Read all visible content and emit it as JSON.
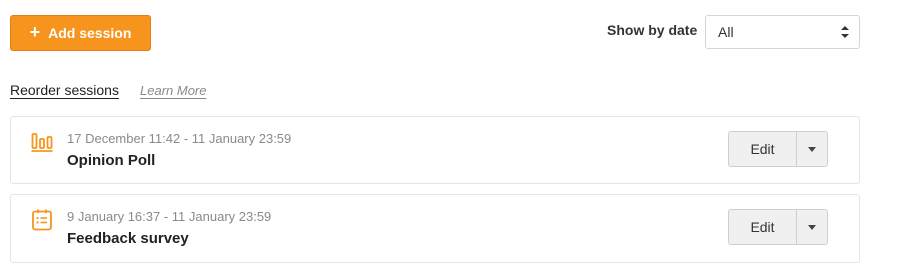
{
  "toolbar": {
    "add_session_label": "Add session",
    "show_by_date_label": "Show by date",
    "date_filter": {
      "selected": "All"
    }
  },
  "links": {
    "reorder": "Reorder sessions",
    "learn_more": "Learn More"
  },
  "sessions": [
    {
      "icon": "poll-icon",
      "date_range": "17 December 11:42 - 11 January 23:59",
      "title": "Opinion Poll",
      "edit_label": "Edit"
    },
    {
      "icon": "survey-icon",
      "date_range": "9 January 16:37 - 11 January 23:59",
      "title": "Feedback survey",
      "edit_label": "Edit"
    }
  ],
  "colors": {
    "accent": "#f7941d",
    "muted_text": "#8a8a8a"
  }
}
